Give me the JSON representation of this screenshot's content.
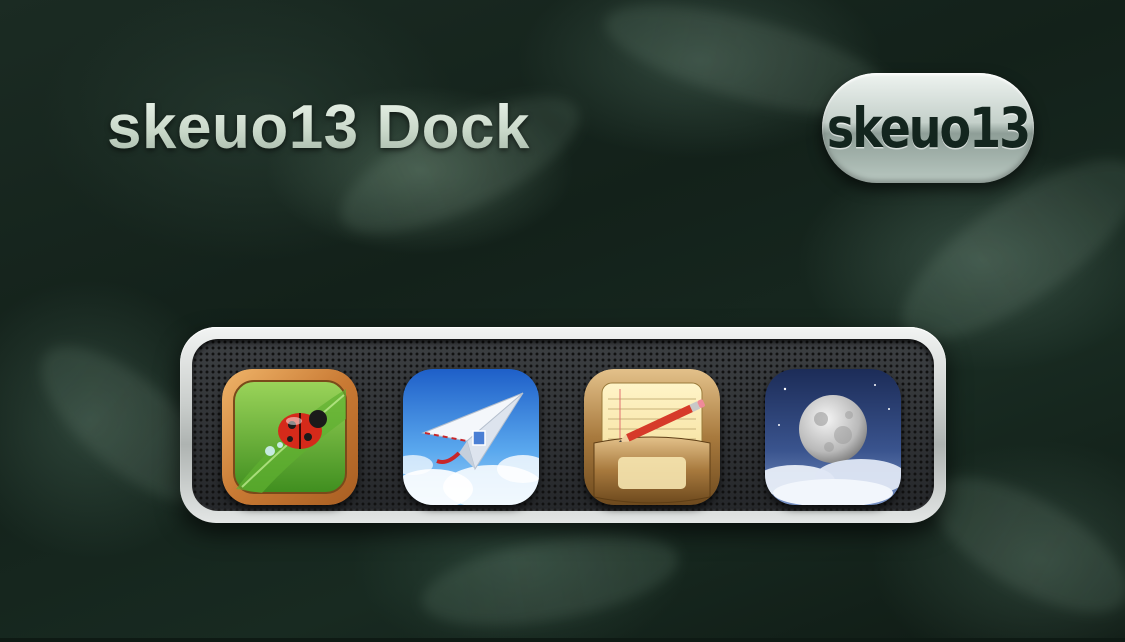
{
  "header": {
    "title": "skeuo13 Dock",
    "logo_text": "skeuo13"
  },
  "dock": {
    "items": [
      {
        "icon": "ladybug-icon"
      },
      {
        "icon": "paper-plane-mail-icon"
      },
      {
        "icon": "notepad-pencil-icon"
      },
      {
        "icon": "moon-weather-icon"
      }
    ]
  },
  "colors": {
    "title": "#dce8dc",
    "dock_frame": "#c9cdcb",
    "dock_mesh": "#2a2c2e"
  }
}
